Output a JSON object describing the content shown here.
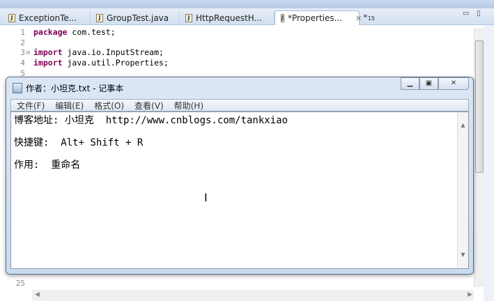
{
  "eclipse": {
    "tabs": [
      {
        "label": "ExceptionTe..."
      },
      {
        "label": "GroupTest.java"
      },
      {
        "label": "HttpRequestH..."
      },
      {
        "label": "*Properties...",
        "active": true
      }
    ],
    "overflow_count": "15",
    "code_lines": [
      {
        "n": "1",
        "kw": "package",
        "rest": " com.test;"
      },
      {
        "n": "2",
        "kw": "",
        "rest": ""
      },
      {
        "n": "3",
        "kw": "import",
        "rest": " java.io.InputStream;"
      },
      {
        "n": "4",
        "kw": "import",
        "rest": " java.util.Properties;"
      },
      {
        "n": "5",
        "kw": "",
        "rest": ""
      }
    ],
    "line_25": "25"
  },
  "notepad": {
    "title": "作者：小坦克.txt - 记事本",
    "menu": [
      "文件(F)",
      "编辑(E)",
      "格式(O)",
      "查看(V)",
      "帮助(H)"
    ],
    "lines": [
      "博客地址: 小坦克  http://www.cnblogs.com/tankxiao",
      "快捷键:  Alt+ Shift + R",
      "作用:  重命名"
    ]
  }
}
